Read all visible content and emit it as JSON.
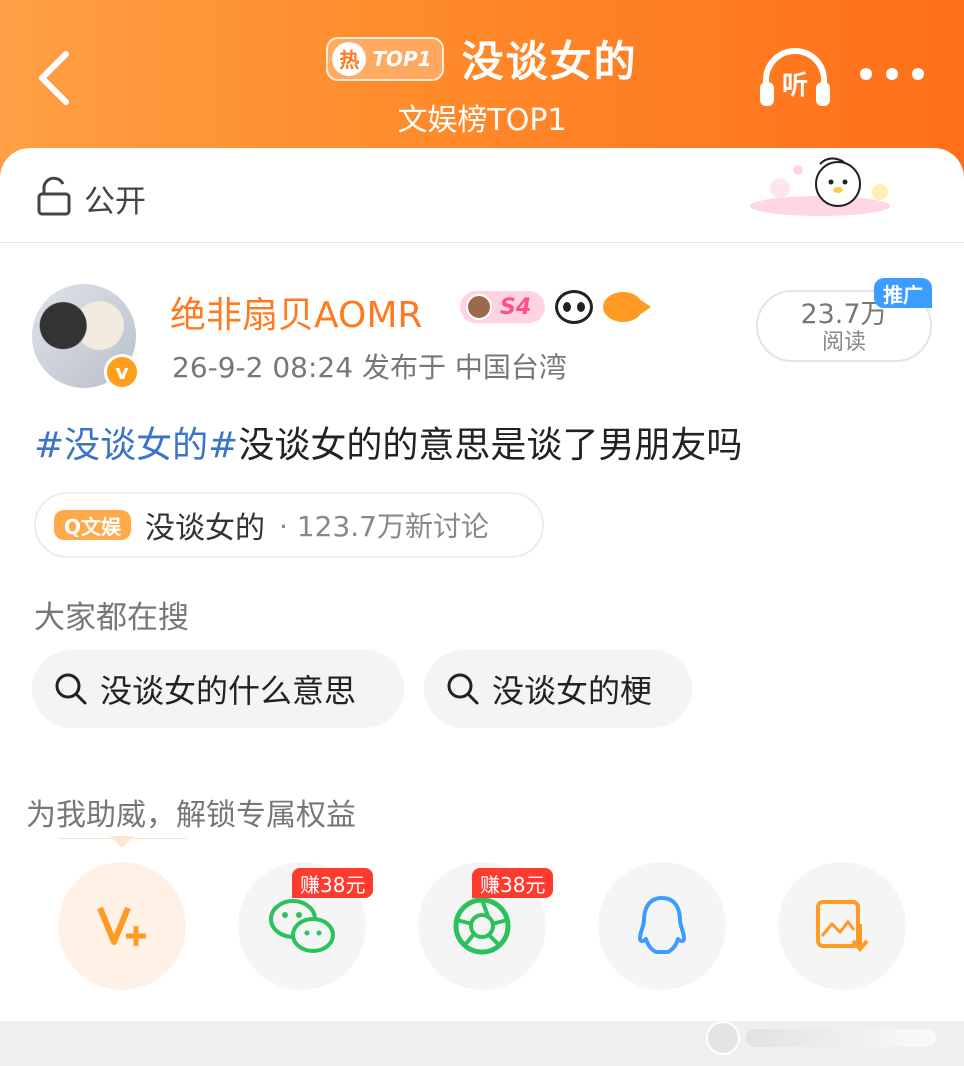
{
  "header": {
    "hot_label": "热",
    "top_label": "TOP1",
    "title": "没谈女的",
    "subtitle": "文娱榜TOP1",
    "listen_label": "听",
    "more_icon": "more-dots-icon",
    "back_icon": "chevron-left-icon"
  },
  "visibility": {
    "label": "公开",
    "icon": "lock-open-icon"
  },
  "post": {
    "username": "绝非扇贝AOMR",
    "level_label": "S4",
    "verified_label": "v",
    "meta": "26-9-2 08:24  发布于 中国台湾",
    "read_count": "23.7万",
    "read_label": "阅读",
    "promo_label": "推广",
    "hashtag": "#没谈女的#",
    "body": "没谈女的的意思是谈了男朋友吗"
  },
  "topic": {
    "tag": "Q文娱",
    "name": "没谈女的",
    "count": "· 123.7万新讨论"
  },
  "search": {
    "heading": "大家都在搜",
    "items": [
      {
        "label": "没谈女的什么意思"
      },
      {
        "label": "没谈女的梗"
      }
    ]
  },
  "support": {
    "heading": "为我助威，解锁专属权益",
    "reward_label": "赚38元"
  },
  "share": [
    {
      "icon": "v-plus-icon"
    },
    {
      "icon": "wechat-icon"
    },
    {
      "icon": "moments-icon"
    },
    {
      "icon": "qq-icon"
    },
    {
      "icon": "save-image-icon"
    }
  ],
  "colors": {
    "header_start": "#ff9f45",
    "header_end": "#ff6f1a",
    "accent": "#ff7a1f",
    "hashtag": "#3a73c8",
    "wechat": "#2bc15b",
    "qq": "#3d9cff",
    "reward": "#ff3b30"
  }
}
